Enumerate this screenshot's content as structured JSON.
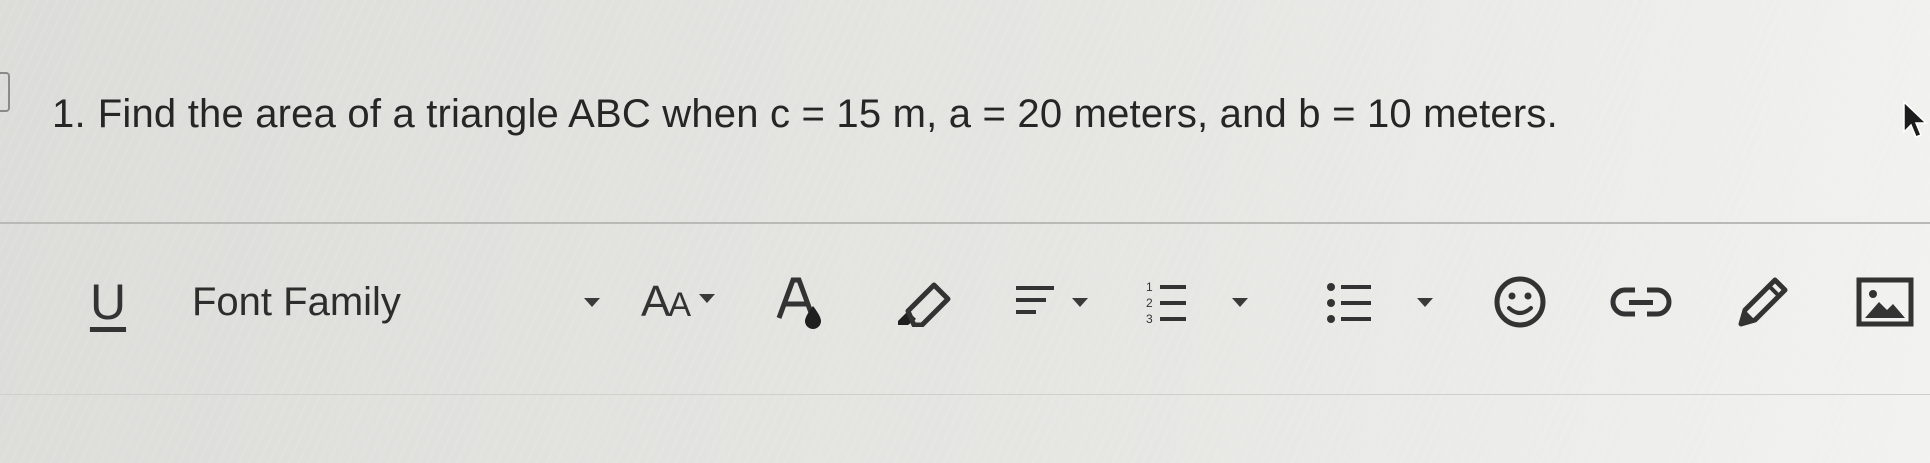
{
  "question": {
    "number": "1.",
    "text": "Find the area of a triangle ABC when c = 15 m, a = 20 meters, and b = 10 meters."
  },
  "toolbar": {
    "underline_label": "U",
    "font_family_label": "Font Family",
    "font_size_label_large": "A",
    "font_size_label_small": "A",
    "icons": [
      "underline-icon",
      "font-family-dropdown",
      "font-size-icon",
      "text-color-icon",
      "highlight-icon",
      "align-icon",
      "ordered-list-icon",
      "bullet-list-icon",
      "emoji-icon",
      "link-icon",
      "pencil-icon",
      "image-icon"
    ]
  },
  "colors": {
    "text": "#262626",
    "icon": "#333333",
    "divider": "#b9b9b6"
  }
}
